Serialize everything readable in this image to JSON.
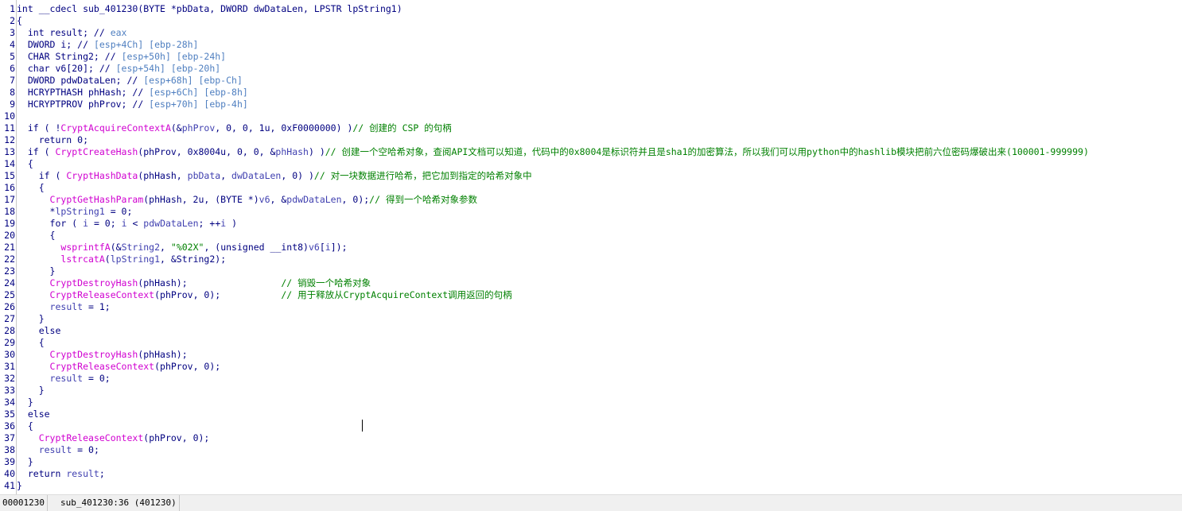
{
  "editor": {
    "line_numbers": [
      "1",
      "2",
      "3",
      "4",
      "5",
      "6",
      "7",
      "8",
      "9",
      "10",
      "11",
      "12",
      "13",
      "14",
      "15",
      "16",
      "17",
      "18",
      "19",
      "20",
      "21",
      "22",
      "23",
      "24",
      "25",
      "26",
      "27",
      "28",
      "29",
      "30",
      "31",
      "32",
      "33",
      "34",
      "35",
      "36",
      "37",
      "38",
      "39",
      "40",
      "41"
    ],
    "lines": [
      [
        [
          "p",
          "int __cdecl sub_401230(BYTE *pbData, DWORD dwDataLen, LPSTR lpString1)"
        ]
      ],
      [
        [
          "p",
          "{"
        ]
      ],
      [
        [
          "p",
          "  int result; // "
        ],
        [
          "r",
          "eax"
        ]
      ],
      [
        [
          "p",
          "  DWORD i; // "
        ],
        [
          "r",
          "[esp+4Ch] [ebp-28h]"
        ]
      ],
      [
        [
          "p",
          "  CHAR String2; // "
        ],
        [
          "r",
          "[esp+50h] [ebp-24h]"
        ]
      ],
      [
        [
          "p",
          "  char v6[20]; // "
        ],
        [
          "r",
          "[esp+54h] [ebp-20h]"
        ]
      ],
      [
        [
          "p",
          "  DWORD pdwDataLen; // "
        ],
        [
          "r",
          "[esp+68h] [ebp-Ch]"
        ]
      ],
      [
        [
          "p",
          "  HCRYPTHASH phHash; // "
        ],
        [
          "r",
          "[esp+6Ch] [ebp-8h]"
        ]
      ],
      [
        [
          "p",
          "  HCRYPTPROV phProv; // "
        ],
        [
          "r",
          "[esp+70h] [ebp-4h]"
        ]
      ],
      [
        [
          "p",
          ""
        ]
      ],
      [
        [
          "p",
          "  if ( !"
        ],
        [
          "f",
          "CryptAcquireContextA"
        ],
        [
          "p",
          "(&"
        ],
        [
          "v",
          "phProv"
        ],
        [
          "p",
          ", 0, 0, 1u, 0xF0000000) )"
        ],
        [
          "c",
          "// 创建的 CSP 的句柄"
        ]
      ],
      [
        [
          "p",
          "    return 0;"
        ]
      ],
      [
        [
          "p",
          "  if ( "
        ],
        [
          "f",
          "CryptCreateHash"
        ],
        [
          "p",
          "(phProv, 0x8004u, 0, 0, &"
        ],
        [
          "v",
          "phHash"
        ],
        [
          "p",
          ") )"
        ],
        [
          "c",
          "// 创建一个空哈希对象，查阅API文档可以知道，代码中的0x8004是标识符并且是sha1的加密算法，所以我们可以用python中的hashlib模块把前六位密码爆破出来(100001-999999)"
        ]
      ],
      [
        [
          "p",
          "  {"
        ]
      ],
      [
        [
          "p",
          "    if ( "
        ],
        [
          "f",
          "CryptHashData"
        ],
        [
          "p",
          "(phHash, "
        ],
        [
          "v",
          "pbData"
        ],
        [
          "p",
          ", "
        ],
        [
          "v",
          "dwDataLen"
        ],
        [
          "p",
          ", 0) )"
        ],
        [
          "c",
          "// 对一块数据进行哈希，把它加到指定的哈希对象中"
        ]
      ],
      [
        [
          "p",
          "    {"
        ]
      ],
      [
        [
          "p",
          "      "
        ],
        [
          "f",
          "CryptGetHashParam"
        ],
        [
          "p",
          "(phHash, 2u, (BYTE *)"
        ],
        [
          "v",
          "v6"
        ],
        [
          "p",
          ", &"
        ],
        [
          "v",
          "pdwDataLen"
        ],
        [
          "p",
          ", 0);"
        ],
        [
          "c",
          "// 得到一个哈希对象参数"
        ]
      ],
      [
        [
          "p",
          "      *"
        ],
        [
          "v",
          "lpString1"
        ],
        [
          "p",
          " = 0;"
        ]
      ],
      [
        [
          "p",
          "      for ( "
        ],
        [
          "v",
          "i"
        ],
        [
          "p",
          " = 0; "
        ],
        [
          "v",
          "i"
        ],
        [
          "p",
          " < "
        ],
        [
          "v",
          "pdwDataLen"
        ],
        [
          "p",
          "; ++"
        ],
        [
          "v",
          "i"
        ],
        [
          "p",
          " )"
        ]
      ],
      [
        [
          "p",
          "      {"
        ]
      ],
      [
        [
          "p",
          "        "
        ],
        [
          "f",
          "wsprintfA"
        ],
        [
          "p",
          "(&"
        ],
        [
          "v",
          "String2"
        ],
        [
          "p",
          ", "
        ],
        [
          "s",
          "\"%02X\""
        ],
        [
          "p",
          ", (unsigned __int8)"
        ],
        [
          "v",
          "v6"
        ],
        [
          "p",
          "["
        ],
        [
          "v",
          "i"
        ],
        [
          "p",
          "]);"
        ]
      ],
      [
        [
          "p",
          "        "
        ],
        [
          "f",
          "lstrcatA"
        ],
        [
          "p",
          "("
        ],
        [
          "v",
          "lpString1"
        ],
        [
          "p",
          ", &String2);"
        ]
      ],
      [
        [
          "p",
          "      }"
        ]
      ],
      [
        [
          "p",
          "      "
        ],
        [
          "f",
          "CryptDestroyHash"
        ],
        [
          "p",
          "(phHash);                 "
        ],
        [
          "c",
          "// 销毁一个哈希对象"
        ]
      ],
      [
        [
          "p",
          "      "
        ],
        [
          "f",
          "CryptReleaseContext"
        ],
        [
          "p",
          "(phProv, 0);           "
        ],
        [
          "c",
          "// 用于释放从CryptAcquireContext调用返回的句柄"
        ]
      ],
      [
        [
          "p",
          "      "
        ],
        [
          "v",
          "result"
        ],
        [
          "p",
          " = 1;"
        ]
      ],
      [
        [
          "p",
          "    }"
        ]
      ],
      [
        [
          "p",
          "    else"
        ]
      ],
      [
        [
          "p",
          "    {"
        ]
      ],
      [
        [
          "p",
          "      "
        ],
        [
          "f",
          "CryptDestroyHash"
        ],
        [
          "p",
          "(phHash);"
        ]
      ],
      [
        [
          "p",
          "      "
        ],
        [
          "f",
          "CryptReleaseContext"
        ],
        [
          "p",
          "(phProv, 0);"
        ]
      ],
      [
        [
          "p",
          "      "
        ],
        [
          "v",
          "result"
        ],
        [
          "p",
          " = 0;"
        ]
      ],
      [
        [
          "p",
          "    }"
        ]
      ],
      [
        [
          "p",
          "  }"
        ]
      ],
      [
        [
          "p",
          "  else"
        ]
      ],
      [
        [
          "p",
          "  {"
        ]
      ],
      [
        [
          "p",
          "    "
        ],
        [
          "f",
          "CryptReleaseContext"
        ],
        [
          "p",
          "(phProv, 0);"
        ]
      ],
      [
        [
          "p",
          "    "
        ],
        [
          "v",
          "result"
        ],
        [
          "p",
          " = 0;"
        ]
      ],
      [
        [
          "p",
          "  }"
        ]
      ],
      [
        [
          "p",
          "  return "
        ],
        [
          "v",
          "result"
        ],
        [
          "p",
          ";"
        ]
      ],
      [
        [
          "p",
          "}"
        ]
      ]
    ]
  },
  "colors": {
    "function": "#d000d0",
    "variable": "#4040b0",
    "plain": "#000080",
    "comment": "#008000",
    "register": "#4f7fc0"
  },
  "statusbar": {
    "address": "00001230",
    "location": "sub_401230:36 (401230)"
  }
}
